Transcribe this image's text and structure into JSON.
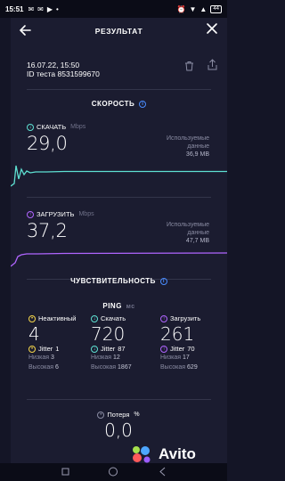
{
  "status_bar": {
    "time": "15:51",
    "battery": "44"
  },
  "header": {
    "title": "РЕЗУЛЬТАТ"
  },
  "meta": {
    "date": "16.07.22, 15:50",
    "test_id": "ID теста 8531599670"
  },
  "speed": {
    "section_title": "СКОРОСТЬ",
    "download": {
      "label": "СКАЧАТЬ",
      "unit": "Mbps",
      "value": "29,0",
      "used_label_1": "Используемые",
      "used_label_2": "данные",
      "used_value": "36,9 MB",
      "color": "#5ee0d2"
    },
    "upload": {
      "label": "ЗАГРУЗИТЬ",
      "unit": "Mbps",
      "value": "37,2",
      "used_label_1": "Используемые",
      "used_label_2": "данные",
      "used_value": "47,7 MB",
      "color": "#b065ff"
    }
  },
  "responsiveness": {
    "section_title": "ЧУВСТВИТЕЛЬНОСТЬ",
    "ping_label": "PING",
    "ping_unit": "мс",
    "idle": {
      "label": "Неактивный",
      "value": "4",
      "jitter_label": "Jitter",
      "jitter": "1",
      "low_label": "Низкая",
      "low": "3",
      "high_label": "Высокая",
      "high": "6",
      "color": "#f5d64a"
    },
    "download": {
      "label": "Скачать",
      "value": "720",
      "jitter_label": "Jitter",
      "jitter": "87",
      "low_label": "Низкая",
      "low": "12",
      "high_label": "Высокая",
      "high": "1867",
      "color": "#5ee0d2"
    },
    "upload": {
      "label": "Загрузить",
      "value": "261",
      "jitter_label": "Jitter",
      "jitter": "70",
      "low_label": "Низкая",
      "low": "17",
      "high_label": "Высокая",
      "high": "629",
      "color": "#b065ff"
    },
    "loss": {
      "label": "Потеря",
      "unit": "%",
      "value": "0,0"
    }
  },
  "watermark": {
    "text": "Avito"
  }
}
